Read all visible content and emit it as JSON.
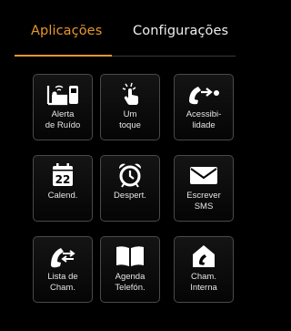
{
  "tabs": {
    "apps": "Aplicações",
    "config": "Configurações"
  },
  "colors": {
    "accent": "#e8982c",
    "background": "#000000",
    "tile_border": "#4a4a4a"
  },
  "tiles": [
    {
      "icon": "noise-alert-icon",
      "label": "Alerta\nde Ruído"
    },
    {
      "icon": "one-touch-icon",
      "label": "Um\ntoque"
    },
    {
      "icon": "accessibility-call-icon",
      "label": "Acessibi-\nlidade"
    },
    {
      "icon": "calendar-icon",
      "label": "Calend.",
      "calendar_day": "22"
    },
    {
      "icon": "alarm-clock-icon",
      "label": "Despert."
    },
    {
      "icon": "envelope-icon",
      "label": "Escrever\nSMS"
    },
    {
      "icon": "call-list-icon",
      "label": "Lista de\nCham."
    },
    {
      "icon": "phonebook-icon",
      "label": "Agenda\nTelefón."
    },
    {
      "icon": "internal-call-icon",
      "label": "Cham.\nInterna"
    }
  ]
}
